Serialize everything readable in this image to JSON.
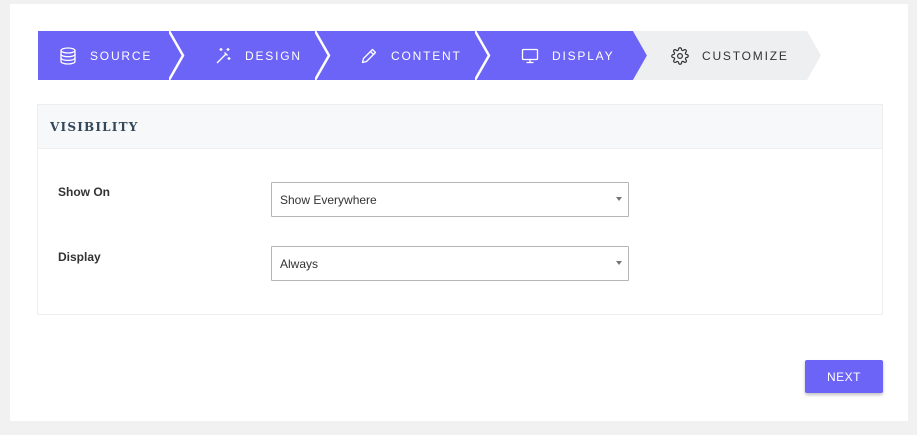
{
  "colors": {
    "step_done": "#6c63f7",
    "step_active": "#eeeff1",
    "accent": "#6c63f7"
  },
  "steps": [
    {
      "label": "Source",
      "icon": "database-icon",
      "state": "done"
    },
    {
      "label": "Design",
      "icon": "magic-wand-icon",
      "state": "done"
    },
    {
      "label": "Content",
      "icon": "pencil-icon",
      "state": "done"
    },
    {
      "label": "Display",
      "icon": "monitor-icon",
      "state": "done"
    },
    {
      "label": "Customize",
      "icon": "gear-icon",
      "state": "active"
    }
  ],
  "section": {
    "title": "VISIBILITY",
    "fields": [
      {
        "label": "Show On",
        "value": "Show Everywhere"
      },
      {
        "label": "Display",
        "value": "Always"
      }
    ]
  },
  "actions": {
    "next_label": "NEXT"
  }
}
